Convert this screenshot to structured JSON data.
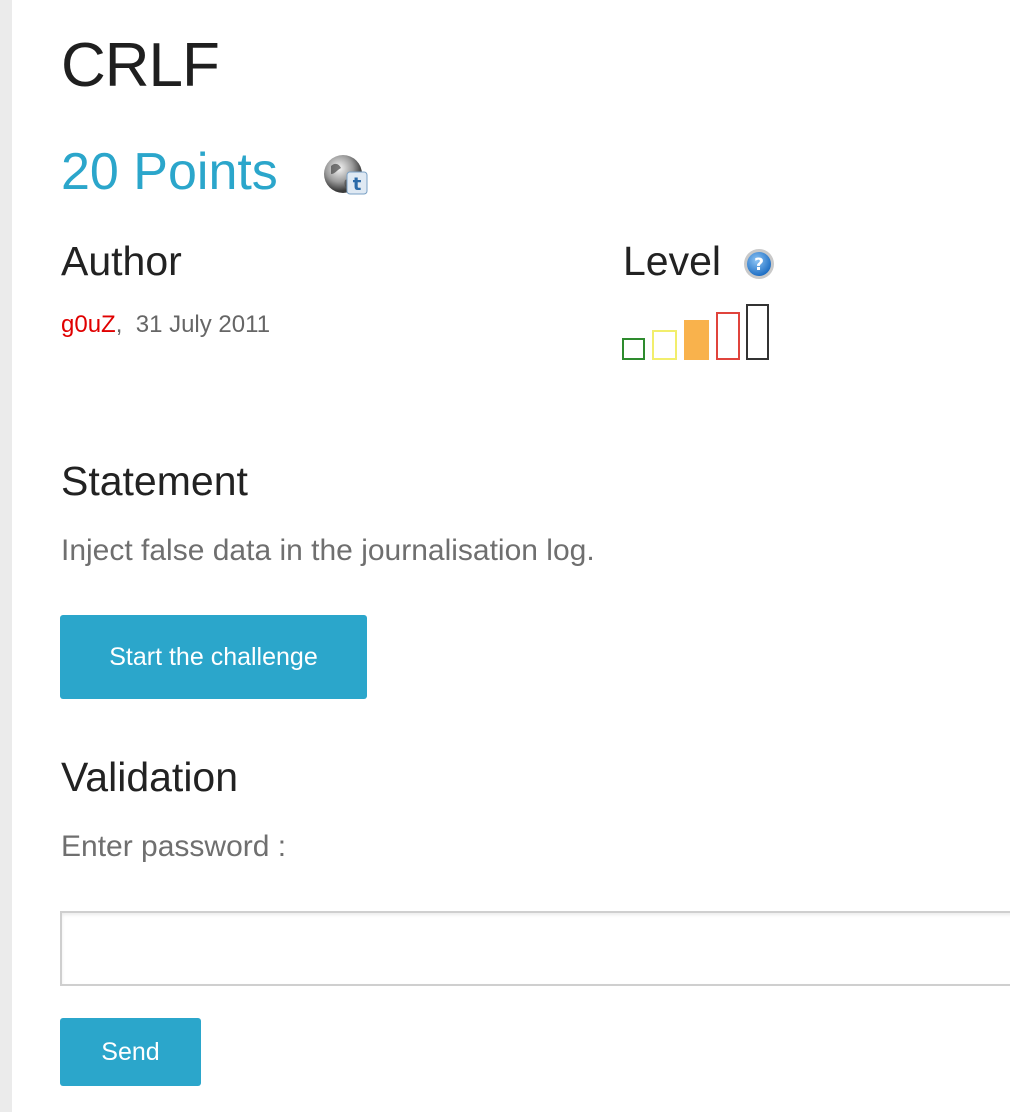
{
  "challenge": {
    "title": "CRLF",
    "points": "20 Points",
    "tweet_icon": "twitter-share-icon"
  },
  "author": {
    "heading": "Author",
    "name": "g0uZ",
    "separator": ",",
    "date": "31 July 2011"
  },
  "level": {
    "heading": "Level",
    "help_icon": "help-question-icon",
    "scale_max": 5,
    "current": 3,
    "colors": [
      "#2e8b2e",
      "#f2ee6c",
      "#f9b24c",
      "#e0443c",
      "#333333"
    ]
  },
  "statement": {
    "heading": "Statement",
    "text": "Inject false data in the journalisation log."
  },
  "start_button": {
    "label": "Start the challenge"
  },
  "validation": {
    "heading": "Validation",
    "password_label": "Enter password :",
    "password_value": "",
    "password_placeholder": "",
    "send_label": "Send"
  },
  "colors": {
    "accent": "#2ba6cb",
    "author_name": "#e00000"
  }
}
